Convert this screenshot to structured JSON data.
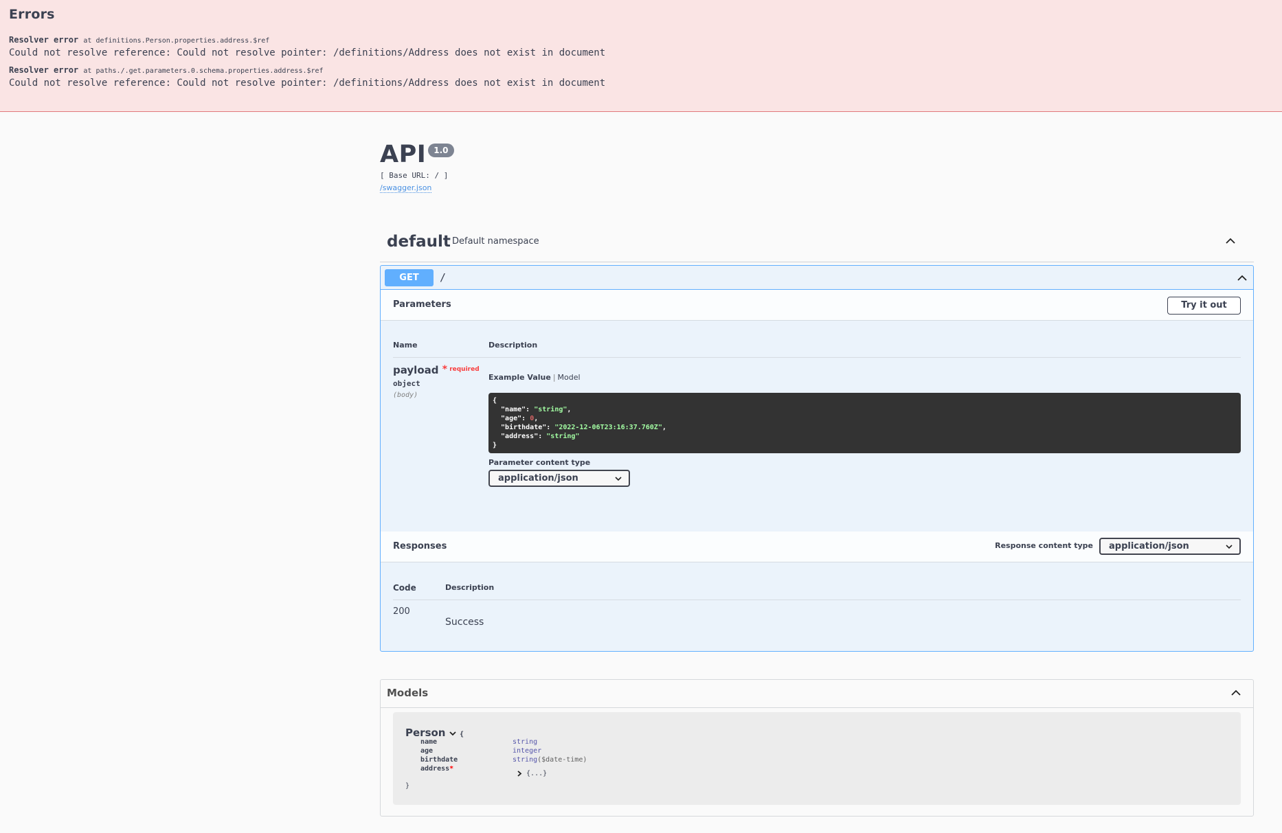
{
  "errors": {
    "title": "Errors",
    "items": [
      {
        "label": "Resolver error",
        "at": "at definitions.Person.properties.address.$ref",
        "message": "Could not resolve reference: Could not resolve pointer: /definitions/Address does not exist in document"
      },
      {
        "label": "Resolver error",
        "at": "at paths./.get.parameters.0.schema.properties.address.$ref",
        "message": "Could not resolve reference: Could not resolve pointer: /definitions/Address does not exist in document"
      }
    ]
  },
  "info": {
    "title": "API",
    "version": "1.0",
    "base_url": "[ Base URL: / ]",
    "spec_link": "/swagger.json"
  },
  "tag": {
    "name": "default",
    "description": "Default namespace"
  },
  "operation": {
    "method": "GET",
    "path": "/",
    "parameters_title": "Parameters",
    "try_label": "Try it out",
    "col_name": "Name",
    "col_description": "Description",
    "param": {
      "name": "payload",
      "required_star": "*",
      "required_label": "required",
      "type": "object",
      "in": "(body)"
    },
    "tab_example": "Example Value",
    "tab_sep": "|",
    "tab_model": "Model",
    "example": {
      "open": "{",
      "line1_key": "  \"name\": ",
      "line1_val": "\"string\"",
      "line2_key": "  \"age\": ",
      "line2_val": "0",
      "line3_key": "  \"birthdate\": ",
      "line3_val": "\"2022-12-06T23:16:37.760Z\"",
      "line4_key": "  \"address\": ",
      "line4_val": "\"string\"",
      "close": "}",
      "comma": ","
    },
    "param_ct_label": "Parameter content type",
    "param_ct_value": "application/json",
    "responses_title": "Responses",
    "resp_ct_label": "Response content type",
    "resp_ct_value": "application/json",
    "col_code": "Code",
    "resp_code": "200",
    "resp_desc": "Success"
  },
  "models": {
    "title": "Models",
    "model_name": "Person",
    "open_brace": "{",
    "close_brace": "}",
    "props": [
      {
        "name": "name",
        "type": "string",
        "format": ""
      },
      {
        "name": "age",
        "type": "integer",
        "format": ""
      },
      {
        "name": "birthdate",
        "type": "string",
        "format": "($date-time)"
      },
      {
        "name": "address",
        "type": "{...}",
        "format": "",
        "required": "*"
      }
    ]
  },
  "colors": {
    "error_bg": "#fae4e4",
    "get_accent": "#61affe",
    "opblock_bg": "#ebf3fb",
    "required_red": "#f93e3e"
  }
}
